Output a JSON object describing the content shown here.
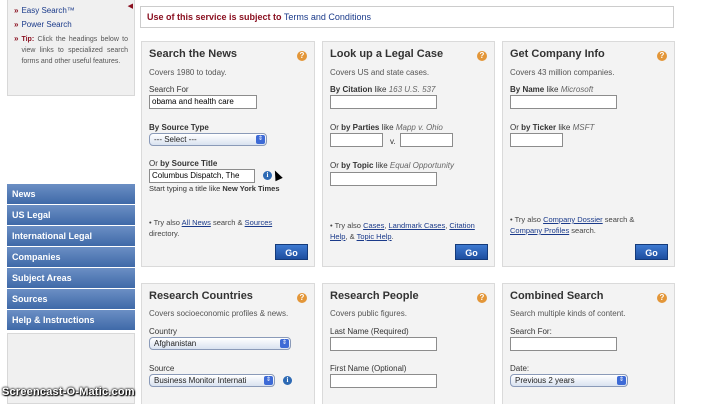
{
  "sidebar": {
    "links": [
      "Easy Search™",
      "Power Search"
    ],
    "tip_label": "Tip:",
    "tip_text": "Click the headings below to view links to specialized search forms and other useful features.",
    "nav": [
      "News",
      "US Legal",
      "International Legal",
      "Companies",
      "Subject Areas",
      "Sources",
      "Help & Instructions"
    ]
  },
  "header": {
    "warning": "Use of this service is subject to",
    "terms_link": "Terms and Conditions"
  },
  "news": {
    "title": "Search the News",
    "subtitle": "Covers 1980 to today.",
    "search_for_label": "Search For",
    "search_for_value": "obama and health care",
    "by_source_type_label": "By Source Type",
    "source_type_value": "--- Select ---",
    "or_label": "Or",
    "by_source_title_label": "by Source Title",
    "source_title_value": "Columbus Dispatch, The",
    "hint_pre": "Start typing a title like",
    "hint_example": "New York Times",
    "try_pre": "Try also",
    "all_news": "All News",
    "search_and": "search &",
    "sources": "Sources",
    "directory": "directory.",
    "go": "Go"
  },
  "legal": {
    "title": "Look up a Legal Case",
    "subtitle": "Covers US and state cases.",
    "by_citation": "By Citation",
    "citation_like": "like",
    "citation_example": "163 U.S. 537",
    "or_label": "Or",
    "by_parties": "by Parties",
    "parties_like": "like",
    "parties_example": "Mapp v. Ohio",
    "v_label": "v.",
    "by_topic": "by Topic",
    "topic_like": "like",
    "topic_example": "Equal Opportunity",
    "try_pre": "Try also",
    "cases": "Cases",
    "landmark": "Landmark Cases",
    "citation_help": "Citation Help",
    "and": "&",
    "topic_help": "Topic Help",
    "go": "Go"
  },
  "company": {
    "title": "Get Company Info",
    "subtitle": "Covers 43 million companies.",
    "by_name": "By Name",
    "name_like": "like",
    "name_example": "Microsoft",
    "or_label": "Or",
    "by_ticker": "by Ticker",
    "ticker_like": "like",
    "ticker_example": "MSFT",
    "try_pre": "Try also",
    "dossier": "Company Dossier",
    "search_and": "search &",
    "profiles": "Company Profiles",
    "search_end": "search.",
    "go": "Go"
  },
  "countries": {
    "title": "Research Countries",
    "subtitle": "Covers socioeconomic profiles & news.",
    "country_label": "Country",
    "country_value": "Afghanistan",
    "source_label": "Source",
    "source_value": "Business Monitor Internati"
  },
  "people": {
    "title": "Research People",
    "subtitle": "Covers public figures.",
    "last_name_label": "Last Name (Required)",
    "first_name_label": "First Name (Optional)"
  },
  "combined": {
    "title": "Combined Search",
    "subtitle": "Search multiple kinds of content.",
    "search_for_label": "Search For:",
    "date_label": "Date:",
    "date_value": "Previous 2 years"
  },
  "watermark": "Screencast-O-Matic.com",
  "colors": {
    "accent": "#8a1020",
    "nav": "#4a72b0",
    "link": "#1a3a8a",
    "help": "#e39638"
  }
}
